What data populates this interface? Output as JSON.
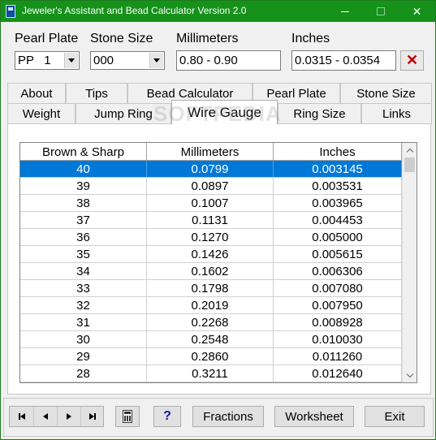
{
  "window": {
    "title": "Jeweler's Assistant and Bead Calculator Version 2.0",
    "accent_color": "#16911a"
  },
  "top_fields": {
    "pearl_plate_label": "Pearl Plate",
    "pearl_plate_value": "PP   1",
    "stone_size_label": "Stone Size",
    "stone_size_value": "000",
    "millimeters_label": "Millimeters",
    "millimeters_value": "0.80 - 0.90",
    "inches_label": "Inches",
    "inches_value": "0.0315 - 0.0354",
    "clear_icon": "close-x"
  },
  "tabs": {
    "row1": [
      "About",
      "Tips",
      "Bead Calculator",
      "Pearl Plate",
      "Stone Size"
    ],
    "row2": [
      "Weight",
      "Jump Ring",
      "Wire Gauge",
      "Ring Size",
      "Links"
    ],
    "active": "Wire Gauge"
  },
  "watermark": "SOFTPEDIA",
  "table": {
    "headers": [
      "Brown & Sharp",
      "Millimeters",
      "Inches"
    ],
    "selected_row": 0,
    "rows": [
      [
        "40",
        "0.0799",
        "0.003145"
      ],
      [
        "39",
        "0.0897",
        "0.003531"
      ],
      [
        "38",
        "0.1007",
        "0.003965"
      ],
      [
        "37",
        "0.1131",
        "0.004453"
      ],
      [
        "36",
        "0.1270",
        "0.005000"
      ],
      [
        "35",
        "0.1426",
        "0.005615"
      ],
      [
        "34",
        "0.1602",
        "0.006306"
      ],
      [
        "33",
        "0.1798",
        "0.007080"
      ],
      [
        "32",
        "0.2019",
        "0.007950"
      ],
      [
        "31",
        "0.2268",
        "0.008928"
      ],
      [
        "30",
        "0.2548",
        "0.010030"
      ],
      [
        "29",
        "0.2860",
        "0.011260"
      ],
      [
        "28",
        "0.3211",
        "0.012640"
      ]
    ]
  },
  "bottom": {
    "nav_icons": [
      "first-record-icon",
      "prev-record-icon",
      "next-record-icon",
      "last-record-icon"
    ],
    "calculator_icon": "calculator-icon",
    "help_label": "?",
    "fractions_label": "Fractions",
    "worksheet_label": "Worksheet",
    "exit_label": "Exit"
  }
}
